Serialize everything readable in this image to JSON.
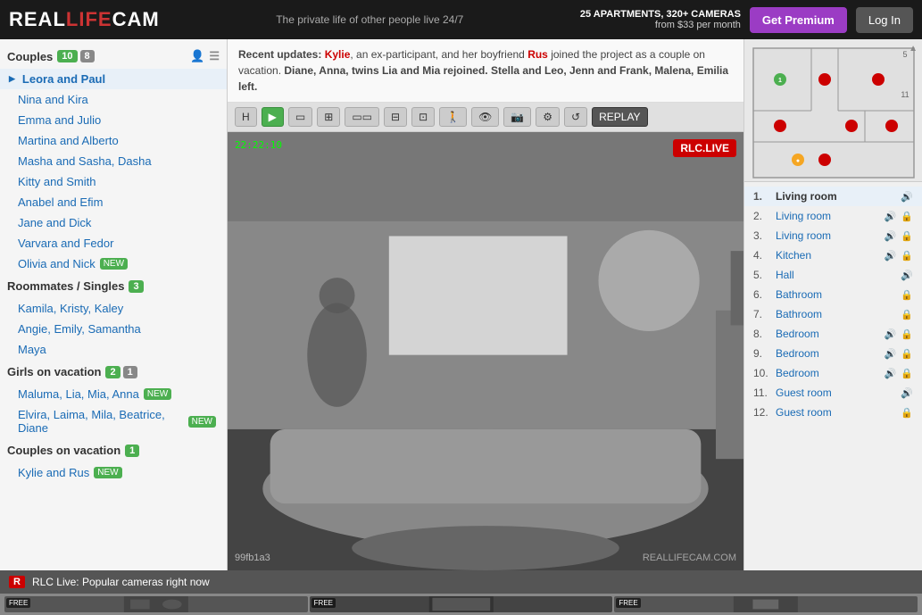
{
  "header": {
    "logo_real": "REAL",
    "logo_life": "LIFE",
    "logo_cam": "CAM",
    "tagline": "The private life of other people live 24/7",
    "apartments_count": "25 APARTMENTS, 320+ CAMERAS",
    "price_info": "from $33 per month",
    "btn_premium": "Get Premium",
    "btn_login": "Log In"
  },
  "notice": {
    "text_before": "Recent updates:",
    "kylie": "Kylie",
    "text1": ", an ex-participant, and her boyfriend ",
    "rus": "Rus",
    "text2": " joined the project as a couple on vacation. ",
    "text3": "Diane, Anna, twins Lia and Mia rejoined.",
    "text4": " Stella and Leo, Jenn and Frank, Malena, Emilia left."
  },
  "sidebar": {
    "couples_label": "Couples",
    "couples_online": "10",
    "couples_total": "8",
    "couples": [
      {
        "name": "Leora and Paul",
        "active": true
      },
      {
        "name": "Nina and Kira",
        "active": false
      },
      {
        "name": "Emma and Julio",
        "active": false
      },
      {
        "name": "Martina and Alberto",
        "active": false
      },
      {
        "name": "Masha and Sasha, Dasha",
        "active": false
      },
      {
        "name": "Kitty and Smith",
        "active": false
      },
      {
        "name": "Anabel and Efim",
        "active": false
      },
      {
        "name": "Jane and Dick",
        "active": false
      },
      {
        "name": "Varvara and Fedor",
        "active": false
      },
      {
        "name": "Olivia and Nick",
        "active": false,
        "new": true
      }
    ],
    "roommates_label": "Roommates / Singles",
    "roommates_count": "3",
    "roommates": [
      {
        "name": "Kamila, Kristy, Kaley"
      },
      {
        "name": "Angie, Emily, Samantha"
      },
      {
        "name": "Maya"
      }
    ],
    "girls_label": "Girls on vacation",
    "girls_online": "2",
    "girls_total": "1",
    "girls": [
      {
        "name": "Maluma, Lia, Mia, Anna",
        "new": true
      },
      {
        "name": "Elvira, Laima, Mila, Beatrice, Diane",
        "new": true
      }
    ],
    "couples_vacation_label": "Couples on vacation",
    "couples_vacation_count": "1",
    "couples_vacation": [
      {
        "name": "Kylie and Rus",
        "new": true
      }
    ]
  },
  "video": {
    "timestamp": "22:22:10",
    "live_badge": "RLC.LIVE",
    "watermark": "REALLIFECAM.COM",
    "cam_id": "99fb1a3",
    "replay_label": "REPLAY"
  },
  "rooms": {
    "collapse_icon": "▲",
    "items": [
      {
        "num": "1.",
        "name": "Living room",
        "sound": true,
        "lock": false,
        "active": true
      },
      {
        "num": "2.",
        "name": "Living room",
        "sound": true,
        "lock": true,
        "active": false
      },
      {
        "num": "3.",
        "name": "Living room",
        "sound": true,
        "lock": true,
        "active": false
      },
      {
        "num": "4.",
        "name": "Kitchen",
        "sound": true,
        "lock": true,
        "active": false
      },
      {
        "num": "5.",
        "name": "Hall",
        "sound": true,
        "lock": false,
        "active": false
      },
      {
        "num": "6.",
        "name": "Bathroom",
        "sound": false,
        "lock": true,
        "active": false
      },
      {
        "num": "7.",
        "name": "Bathroom",
        "sound": false,
        "lock": true,
        "active": false
      },
      {
        "num": "8.",
        "name": "Bedroom",
        "sound": true,
        "lock": true,
        "active": false
      },
      {
        "num": "9.",
        "name": "Bedroom",
        "sound": true,
        "lock": true,
        "active": false
      },
      {
        "num": "10.",
        "name": "Bedroom",
        "sound": true,
        "lock": true,
        "active": false
      },
      {
        "num": "11.",
        "name": "Guest room",
        "sound": true,
        "lock": false,
        "active": false
      },
      {
        "num": "12.",
        "name": "Guest room",
        "sound": false,
        "lock": true,
        "active": false
      }
    ]
  },
  "popular": {
    "icon": "R",
    "label": "RLC Live: Popular cameras right now",
    "thumbnails": [
      {
        "label": "FREE"
      },
      {
        "label": "FREE"
      },
      {
        "label": "FREE"
      }
    ]
  }
}
